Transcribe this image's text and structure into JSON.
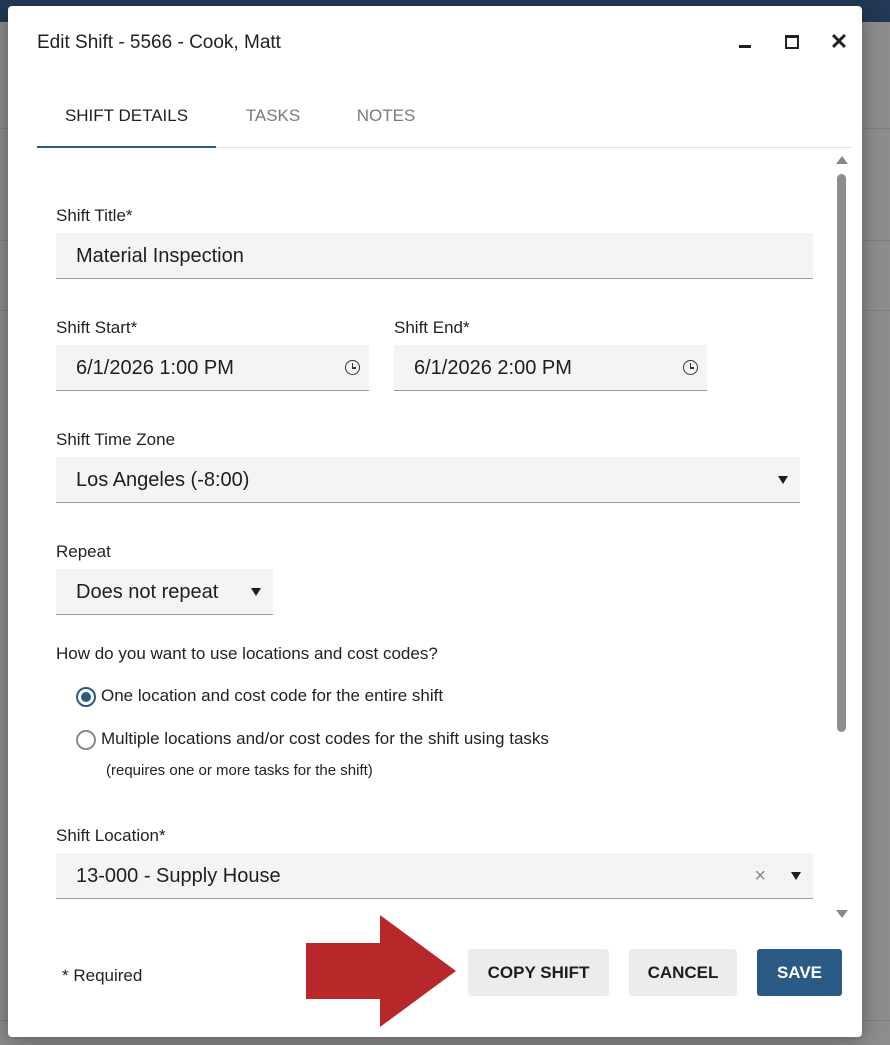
{
  "dialog": {
    "title": "Edit Shift - 5566 - Cook, Matt"
  },
  "tabs": [
    {
      "label": "SHIFT DETAILS",
      "active": true
    },
    {
      "label": "TASKS",
      "active": false
    },
    {
      "label": "NOTES",
      "active": false
    }
  ],
  "form": {
    "shift_title_label": "Shift Title*",
    "shift_title_value": "Material Inspection",
    "shift_start_label": "Shift Start*",
    "shift_start_value": "6/1/2026 1:00 PM",
    "shift_end_label": "Shift End*",
    "shift_end_value": "6/1/2026 2:00 PM",
    "time_zone_label": "Shift Time Zone",
    "time_zone_value": "Los Angeles (-8:00)",
    "repeat_label": "Repeat",
    "repeat_value": "Does not repeat",
    "location_question": "How do you want to use locations and cost codes?",
    "option_one": "One location and cost code for the entire shift",
    "option_multiple": "Multiple locations and/or cost codes for the shift using tasks",
    "option_multiple_hint": "(requires one or more tasks for the shift)",
    "location_label": "Shift Location*",
    "location_value": "13-000 - Supply House"
  },
  "footer": {
    "required_note": "* Required",
    "copy_label": "COPY SHIFT",
    "cancel_label": "CANCEL",
    "save_label": "SAVE"
  },
  "icons": {
    "clear": "×",
    "close": "✕"
  },
  "colors": {
    "accent": "#2a5a86",
    "arrow": "#b8282a"
  }
}
